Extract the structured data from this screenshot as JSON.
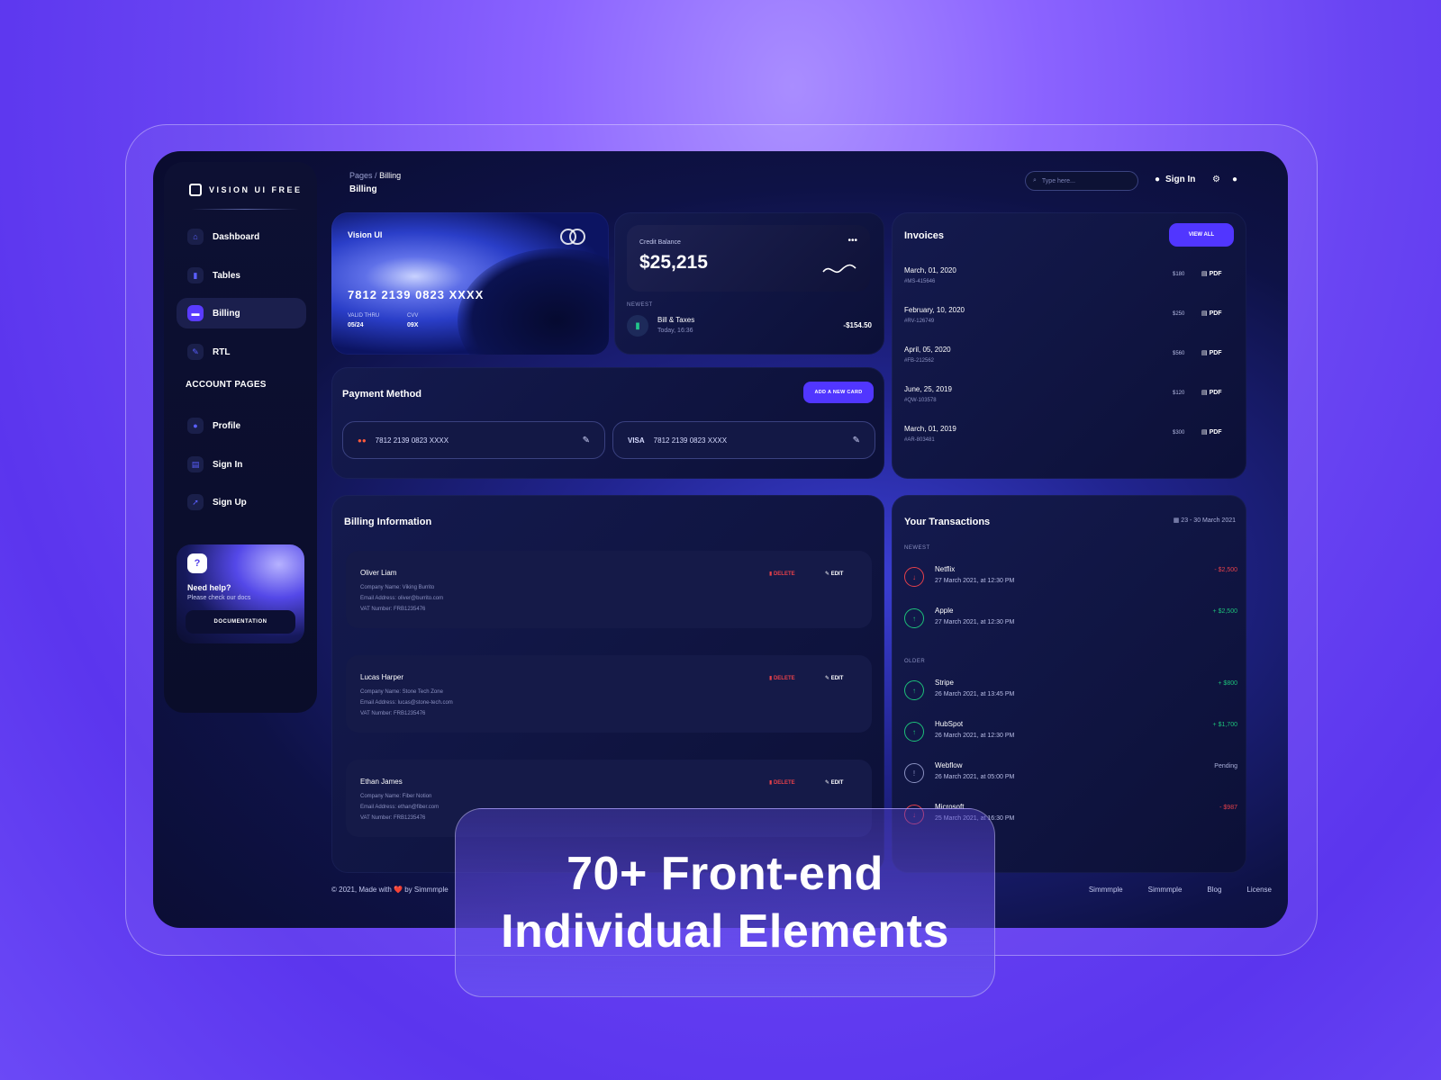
{
  "sidebar": {
    "logo": "VISION UI FREE",
    "items": [
      {
        "label": "Dashboard",
        "icon": "home-icon"
      },
      {
        "label": "Tables",
        "icon": "chart-icon"
      },
      {
        "label": "Billing",
        "icon": "card-icon",
        "active": true
      },
      {
        "label": "RTL",
        "icon": "wrench-icon"
      }
    ],
    "account_title": "ACCOUNT PAGES",
    "account_items": [
      {
        "label": "Profile",
        "icon": "user-icon"
      },
      {
        "label": "Sign In",
        "icon": "document-icon"
      },
      {
        "label": "Sign Up",
        "icon": "rocket-icon"
      }
    ],
    "help": {
      "title": "Need help?",
      "subtitle": "Please check our docs",
      "button": "DOCUMENTATION"
    }
  },
  "header": {
    "breadcrumb_root": "Pages",
    "breadcrumb_current": "Billing",
    "title": "Billing",
    "search_placeholder": "Type here...",
    "signin": "Sign In"
  },
  "credit_card": {
    "label": "Vision UI",
    "number": "7812 2139 0823 XXXX",
    "valid_label": "VALID THRU",
    "valid_value": "05/24",
    "cvv_label": "CVV",
    "cvv_value": "09X"
  },
  "credit_balance": {
    "label": "Credit Balance",
    "amount": "$25,215",
    "newest_label": "NEWEST",
    "bill_name": "Bill & Taxes",
    "bill_time": "Today, 16:36",
    "bill_amount": "-$154.50"
  },
  "payment": {
    "title": "Payment Method",
    "add_button": "ADD A NEW CARD",
    "cards": [
      {
        "brand": "mastercard",
        "number": "7812 2139 0823 XXXX"
      },
      {
        "brand": "VISA",
        "number": "7812 2139 0823 XXXX"
      }
    ]
  },
  "invoices": {
    "title": "Invoices",
    "button": "VIEW ALL",
    "items": [
      {
        "date": "March, 01, 2020",
        "id": "#MS-415646",
        "price": "$180",
        "format": "PDF"
      },
      {
        "date": "February, 10, 2020",
        "id": "#RV-126749",
        "price": "$250",
        "format": "PDF"
      },
      {
        "date": "April, 05, 2020",
        "id": "#FB-212562",
        "price": "$560",
        "format": "PDF"
      },
      {
        "date": "June, 25, 2019",
        "id": "#QW-103578",
        "price": "$120",
        "format": "PDF"
      },
      {
        "date": "March, 01, 2019",
        "id": "#AR-803481",
        "price": "$300",
        "format": "PDF"
      }
    ]
  },
  "billing_info": {
    "title": "Billing Information",
    "delete_label": "DELETE",
    "edit_label": "EDIT",
    "entries": [
      {
        "name": "Oliver Liam",
        "company": "Company Name: Viking Burrito",
        "email": "Email Address: oliver@burrito.com",
        "vat": "VAT Number: FRB1235476"
      },
      {
        "name": "Lucas Harper",
        "company": "Company Name: Stone Tech Zone",
        "email": "Email Address: lucas@stone-tech.com",
        "vat": "VAT Number: FRB1235476"
      },
      {
        "name": "Ethan James",
        "company": "Company Name: Fiber Notion",
        "email": "Email Address: ethan@fiber.com",
        "vat": "VAT Number: FRB1235476"
      }
    ]
  },
  "transactions": {
    "title": "Your Transactions",
    "date_range": "23 - 30 March 2021",
    "newest_label": "NEWEST",
    "older_label": "OLDER",
    "newest": [
      {
        "name": "Netflix",
        "time": "27 March 2021, at 12:30 PM",
        "amount": "- $2,500",
        "status": "negative"
      },
      {
        "name": "Apple",
        "time": "27 March 2021, at 12:30 PM",
        "amount": "+ $2,500",
        "status": "positive"
      }
    ],
    "older": [
      {
        "name": "Stripe",
        "time": "26 March 2021, at 13:45 PM",
        "amount": "+ $800",
        "status": "positive"
      },
      {
        "name": "HubSpot",
        "time": "26 March 2021, at 12:30 PM",
        "amount": "+ $1,700",
        "status": "positive"
      },
      {
        "name": "Webflow",
        "time": "26 March 2021, at 05:00 PM",
        "amount": "Pending",
        "status": "pending"
      },
      {
        "name": "Microsoft",
        "time": "25 March 2021, at 16:30 PM",
        "amount": "- $987",
        "status": "negative"
      }
    ]
  },
  "footer": {
    "copyright": "© 2021, Made with ❤️ by Simmmple",
    "links": [
      "Simmmple",
      "Simmmple",
      "Blog",
      "License"
    ]
  },
  "promo": {
    "line1": "70+ Front-end",
    "line2": "Individual Elements"
  },
  "colors": {
    "accent": "#5136ff",
    "positive": "#1dc07a",
    "negative": "#e5404a",
    "background": "#6a45f3"
  }
}
